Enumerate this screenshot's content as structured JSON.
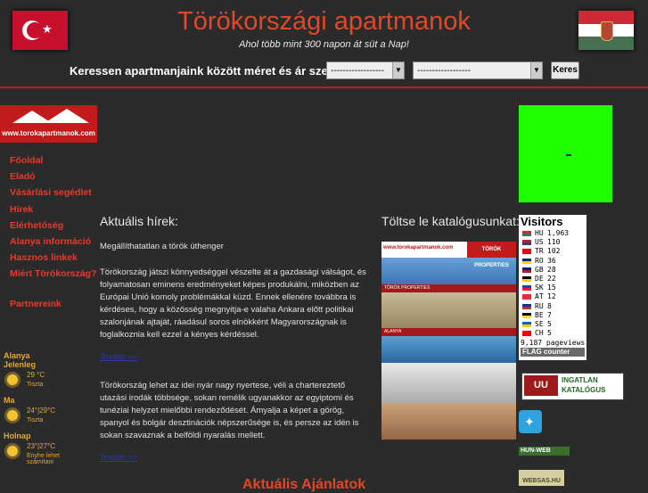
{
  "header": {
    "title": "Törökországi apartmanok",
    "subtitle": "Ahol több mint 300 napon át süt a Nap!",
    "search_label": "Keressen apartmanjaink között méret és ár szerint:",
    "select1_value": "------------------",
    "select2_value": "------------------",
    "search_button": "Keres"
  },
  "logo": {
    "url_text": "www.torokapartmanok.com"
  },
  "nav": {
    "items": [
      "Főoldal",
      "Eladó",
      "Vásárlási segédlet",
      "Hírek",
      "Elérhetőség",
      "Alanya információ",
      "Hasznos linkek",
      "Miért Törökország?"
    ],
    "partners": "Partnereink"
  },
  "weather": [
    {
      "city": "Alanya Jelenleg",
      "temp": "29 °C",
      "desc": "Tiszta"
    },
    {
      "city": "Ma",
      "temp": "24°|29°C",
      "desc": "Tiszta"
    },
    {
      "city": "Holnap",
      "temp": "23°|27°C",
      "desc": "Enyhe lehet számítani"
    }
  ],
  "news": {
    "title": "Aktuális hírek:",
    "headline": "Megállíthatatlan a török úthenger",
    "paragraph1": "Törökország játszi könnyedséggel vészelte át a gazdasági válságot, és folyamatosan eminens eredményeket képes produkálni, miközben az Európai Unió komoly problémákkal küzd. Ennek ellenére továbbra is kérdéses, hogy a közösség megnyitja-e valaha Ankara előtt politikai szalonjának ajtaját, ráadásul soros elnökként Magyarországnak is foglalkoznia kell ezzel a kényes kérdéssel.",
    "more1": "Tovább >>",
    "paragraph2": "Törökország lehet az idei nyár nagy nyertese, véli a chartereztető utazási irodák többsége, sokan remélik ugyanakkor az egyiptomi és tunéziai helyzet mielőbbi rendeződését. Ámyalja a képet a görög, spanyol és bolgár desztinációk népszerűsége is, és persze az idén is sokan szavaznak a belföldi nyaralás mellett.",
    "more2": "Tovább >>",
    "footer": "Aktuális Ajánlatok"
  },
  "catalog": {
    "title": "Töltse le katalógusunkat:",
    "header_left": "www.torokapartmanok.com",
    "header_right": "TÖRÖK PROPERTIES",
    "strip1": "TÖRÖK PROPERTIES",
    "strip2": "ALANYA"
  },
  "visitors": {
    "title": "Visitors",
    "rows": [
      {
        "cc": "HU",
        "count": "1,963",
        "c1": "#ce2939",
        "c2": "#477050"
      },
      {
        "cc": "US",
        "count": "110",
        "c1": "#b22234",
        "c2": "#3c3b6e"
      },
      {
        "cc": "TR",
        "count": "102",
        "c1": "#e30a17",
        "c2": "#e30a17"
      },
      {
        "cc": "RO",
        "count": "36",
        "c1": "#002b7f",
        "c2": "#fcd116"
      },
      {
        "cc": "GB",
        "count": "28",
        "c1": "#012169",
        "c2": "#c8102e"
      },
      {
        "cc": "DE",
        "count": "22",
        "c1": "#000000",
        "c2": "#ffce00"
      },
      {
        "cc": "SK",
        "count": "15",
        "c1": "#0b4ea2",
        "c2": "#ee1c25"
      },
      {
        "cc": "AT",
        "count": "12",
        "c1": "#ed2939",
        "c2": "#ed2939"
      },
      {
        "cc": "RU",
        "count": "8",
        "c1": "#0039a6",
        "c2": "#d52b1e"
      },
      {
        "cc": "BE",
        "count": "7",
        "c1": "#000000",
        "c2": "#fdda24"
      },
      {
        "cc": "SE",
        "count": "5",
        "c1": "#006aa7",
        "c2": "#fecc00"
      },
      {
        "cc": "CH",
        "count": "5",
        "c1": "#ff0000",
        "c2": "#ff0000"
      }
    ],
    "pageviews": "9,187 pageviews",
    "footer": "FLAG counter"
  },
  "banners": {
    "ingatlan_logo": "UU",
    "ingatlan_line1": "INGATLAN",
    "ingatlan_line2": "KATALÓGUS",
    "hunweb": "HUN-WEB",
    "websas": "WEBSAS.HU"
  },
  "colors": {
    "accent_red": "#e14828",
    "nav_red": "#e83a2a",
    "weather_orange": "#e8a72a",
    "background": "#2b2b2b",
    "divider": "#b91d1d",
    "green_box": "#1eff00"
  }
}
